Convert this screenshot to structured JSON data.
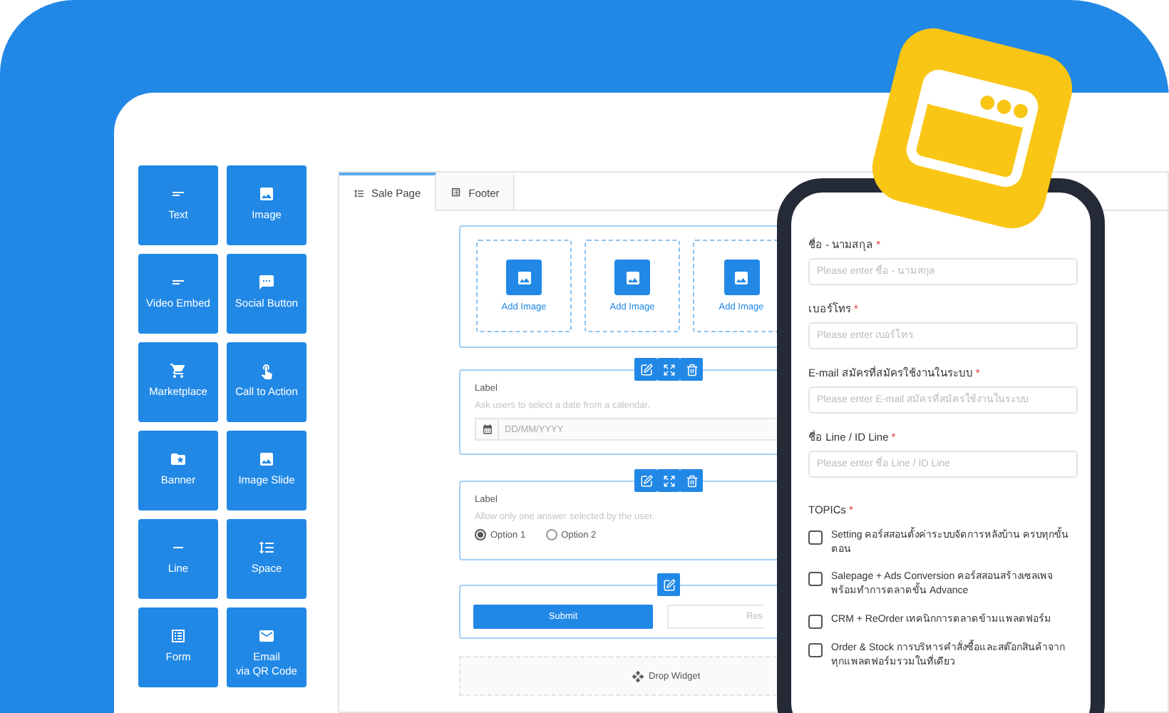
{
  "widgets": [
    {
      "kind": "text",
      "label": "Text"
    },
    {
      "kind": "image",
      "label": "Image"
    },
    {
      "kind": "video",
      "label": "Video Embed"
    },
    {
      "kind": "social",
      "label": "Social Button"
    },
    {
      "kind": "market",
      "label": "Marketplace"
    },
    {
      "kind": "cta",
      "label": "Call to Action"
    },
    {
      "kind": "banner",
      "label": "Banner"
    },
    {
      "kind": "slide",
      "label": "Image Slide"
    },
    {
      "kind": "line",
      "label": "Line"
    },
    {
      "kind": "space",
      "label": "Space"
    },
    {
      "kind": "form",
      "label": "Form"
    },
    {
      "kind": "email",
      "label": "Email\nvia QR Code"
    }
  ],
  "editor": {
    "tabs": [
      {
        "label": "Sale Page",
        "selected": true
      },
      {
        "label": "Footer",
        "selected": false
      }
    ],
    "gallery": [
      "Add Image",
      "Add Image",
      "Add Image"
    ],
    "date_field": {
      "label": "Label",
      "hint": "Ask users to select a date from a calendar.",
      "placeholder": "DD/MM/YYYY"
    },
    "radio_field": {
      "label": "Label",
      "hint": "Allow only one answer selected by the user.",
      "options": [
        {
          "label": "Option 1",
          "selected": true
        },
        {
          "label": "Option 2",
          "selected": false
        }
      ]
    },
    "submit": "Submit",
    "reset": "Res",
    "drop_zone": "Drop Widget"
  },
  "phone_form": {
    "fields": [
      {
        "label": "ชื่อ - นามสกุล",
        "mark": "*",
        "placeholder": "Please enter ชื่อ - นามสกุล"
      },
      {
        "label": "เบอร์โทร",
        "mark": "*",
        "placeholder": "Please enter เบอร์โทร"
      },
      {
        "label": "E-mail สมัครที่สมัครใช้งานในระบบ",
        "mark": "*",
        "placeholder": "Please enter E-mail สมัครที่สมัครใช้งานในระบบ"
      },
      {
        "label": "ชื่อ Line / ID Line",
        "mark": "*",
        "placeholder": "Please enter ชื่อ Line / ID Line"
      }
    ],
    "topics": {
      "label": "TOPICs",
      "mark": "*",
      "options": [
        {
          "label": "Setting คอร์สสอนตั้งค่าระบบจัดการหลังบ้าน ครบทุกขั้นตอน",
          "checked": false
        },
        {
          "label": "Salepage + Ads Conversion คอร์สสอนสร้างเซลเพจ พร้อมทำการตลาดขั้น Advance",
          "checked": false
        },
        {
          "label": "CRM + ReOrder เทคนิกการตลาดข้ามแพลตฟอร์ม",
          "checked": false
        },
        {
          "label": "Order & Stock การบริหารคำสั่งซื้อและสต๊อกสินค้าจากทุกแพลตฟอร์มรวมในที่เดียว",
          "checked": false
        }
      ]
    }
  }
}
